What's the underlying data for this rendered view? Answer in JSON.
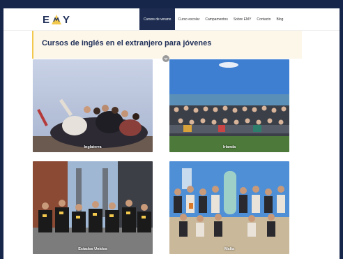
{
  "brand": {
    "logo_text_left": "E",
    "logo_text_right": "Y"
  },
  "nav": {
    "items": [
      {
        "label": "Cursos de verano",
        "active": true
      },
      {
        "label": "Curso escolar",
        "active": false
      },
      {
        "label": "Campamentos",
        "active": false
      },
      {
        "label": "Sobre EMY",
        "active": false
      },
      {
        "label": "Contacto",
        "active": false
      },
      {
        "label": "Blog",
        "active": false
      }
    ]
  },
  "hero": {
    "title": "Cursos de inglés en el extranjero para jóvenes"
  },
  "destinations": [
    {
      "label": "Inglaterra"
    },
    {
      "label": "Irlanda"
    },
    {
      "label": "Estados Unidos"
    },
    {
      "label": "Malta"
    }
  ],
  "colors": {
    "navy": "#1c2b4f",
    "accent": "#f2c94c",
    "frame": "#15264a"
  }
}
